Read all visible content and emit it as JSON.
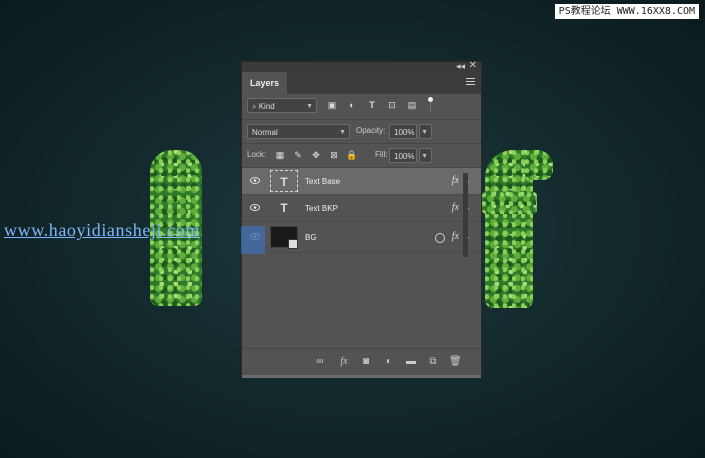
{
  "watermark_top": "PS教程论坛 WWW.16XX8.COM",
  "watermark_mid": "www.haoyidiansheji.com",
  "panel": {
    "title": "Layers",
    "filter_select": "Kind",
    "blend_mode": "Normal",
    "opacity_label": "Opacity:",
    "opacity_value": "100%",
    "lock_label": "Lock:",
    "fill_label": "Fill:",
    "fill_value": "100%",
    "layers": [
      {
        "name": "Text Base",
        "thumb": "T",
        "fx": "fx",
        "selected": true
      },
      {
        "name": "Text BKP",
        "thumb": "T",
        "fx": "fx",
        "selected": false
      },
      {
        "name": "BG",
        "thumb": "",
        "fx": "fx",
        "selected": false
      }
    ],
    "bottom_icons": [
      "link-icon",
      "fx-icon",
      "mask-icon",
      "adjustment-icon",
      "folder-icon",
      "new-layer-icon",
      "trash-icon"
    ],
    "fx_glyph": "fx"
  },
  "colors": {
    "canvas_bg": "#142b2e",
    "panel_bg": "#535353",
    "selected_layer": "#6a6a6a",
    "highlight": "#3d6fb0",
    "leaf_green": "#2f7a2a"
  }
}
